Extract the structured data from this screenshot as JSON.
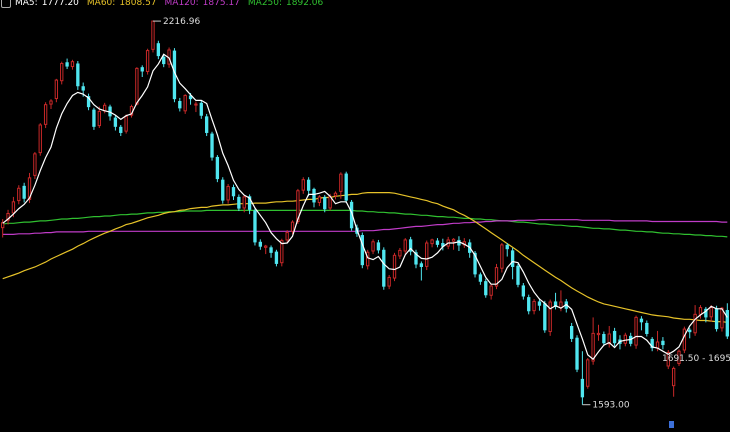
{
  "chart_data": {
    "type": "candlestick",
    "ylim": [
      1560,
      2235
    ],
    "up_color": "#c82828",
    "down_color": "#50e6f0",
    "legend": {
      "ma5": {
        "label": "MA5:",
        "value": "1777.20",
        "color": "#ffffff"
      },
      "ma60": {
        "label": "MA60:",
        "value": "1808.57",
        "color": "#e6c229"
      },
      "ma120": {
        "label": "MA120:",
        "value": "1875.17",
        "color": "#c03cc8"
      },
      "ma250": {
        "label": "MA250:",
        "value": "1892.06",
        "color": "#30c030"
      }
    },
    "annotations": {
      "high": {
        "text": "2216.96",
        "value": 2216.96
      },
      "low": {
        "text": "1593.00",
        "value": 1593.0
      },
      "range_text": "1691.50 - 1695"
    },
    "candles": [
      [
        1881,
        1889,
        1865,
        1895
      ],
      [
        1893,
        1904,
        1886,
        1910
      ],
      [
        1905,
        1923,
        1898,
        1931
      ],
      [
        1925,
        1945,
        1919,
        1950
      ],
      [
        1949,
        1928,
        1922,
        1954
      ],
      [
        1927,
        1962,
        1921,
        1970
      ],
      [
        1966,
        2001,
        1960,
        2004
      ],
      [
        2003,
        2048,
        1998,
        2051
      ],
      [
        2049,
        2081,
        2043,
        2085
      ],
      [
        2082,
        2087,
        2074,
        2090
      ],
      [
        2091,
        2121,
        2085,
        2123
      ],
      [
        2120,
        2148,
        2114,
        2151
      ],
      [
        2150,
        2143,
        2139,
        2156
      ],
      [
        2143,
        2151,
        2138,
        2154
      ],
      [
        2148,
        2111,
        2105,
        2152
      ],
      [
        2111,
        2104,
        2094,
        2117
      ],
      [
        2095,
        2077,
        2072,
        2099
      ],
      [
        2073,
        2045,
        2040,
        2076
      ],
      [
        2047,
        2070,
        2043,
        2078
      ],
      [
        2071,
        2080,
        2067,
        2084
      ],
      [
        2078,
        2062,
        2055,
        2081
      ],
      [
        2060,
        2045,
        2039,
        2064
      ],
      [
        2045,
        2035,
        2030,
        2048
      ],
      [
        2038,
        2062,
        2034,
        2065
      ],
      [
        2064,
        2078,
        2060,
        2081
      ],
      [
        2082,
        2140,
        2080,
        2142
      ],
      [
        2142,
        2135,
        2126,
        2145
      ],
      [
        2135,
        2169,
        2130,
        2172
      ],
      [
        2171,
        2217,
        2166,
        2217
      ],
      [
        2181,
        2160,
        2155,
        2185
      ],
      [
        2159,
        2147,
        2142,
        2162
      ],
      [
        2147,
        2170,
        2141,
        2174
      ],
      [
        2169,
        2090,
        2085,
        2173
      ],
      [
        2087,
        2075,
        2070,
        2092
      ],
      [
        2071,
        2096,
        2066,
        2098
      ],
      [
        2096,
        2090,
        2081,
        2100
      ],
      [
        2082,
        2082,
        2069,
        2086
      ],
      [
        2084,
        2063,
        2058,
        2088
      ],
      [
        2062,
        2035,
        2030,
        2066
      ],
      [
        2034,
        1995,
        1990,
        2037
      ],
      [
        1996,
        1960,
        1955,
        1999
      ],
      [
        1959,
        1925,
        1920,
        1963
      ],
      [
        1926,
        1948,
        1920,
        1952
      ],
      [
        1947,
        1932,
        1926,
        1951
      ],
      [
        1931,
        1912,
        1908,
        1935
      ],
      [
        1913,
        1931,
        1906,
        1934
      ],
      [
        1932,
        1910,
        1903,
        1935
      ],
      [
        1909,
        1857,
        1852,
        1912
      ],
      [
        1858,
        1850,
        1845,
        1862
      ],
      [
        1849,
        1851,
        1838,
        1853
      ],
      [
        1849,
        1840,
        1832,
        1852
      ],
      [
        1842,
        1822,
        1818,
        1845
      ],
      [
        1824,
        1860,
        1818,
        1863
      ],
      [
        1861,
        1873,
        1856,
        1877
      ],
      [
        1875,
        1890,
        1870,
        1893
      ],
      [
        1891,
        1941,
        1887,
        1944
      ],
      [
        1942,
        1959,
        1936,
        1963
      ],
      [
        1959,
        1941,
        1932,
        1963
      ],
      [
        1944,
        1922,
        1914,
        1946
      ],
      [
        1922,
        1931,
        1916,
        1934
      ],
      [
        1931,
        1911,
        1906,
        1934
      ],
      [
        1913,
        1932,
        1909,
        1936
      ],
      [
        1933,
        1937,
        1927,
        1940
      ],
      [
        1940,
        1968,
        1928,
        1971
      ],
      [
        1969,
        1925,
        1921,
        1972
      ],
      [
        1923,
        1880,
        1876,
        1926
      ],
      [
        1881,
        1871,
        1866,
        1886
      ],
      [
        1869,
        1820,
        1815,
        1873
      ],
      [
        1819,
        1841,
        1813,
        1845
      ],
      [
        1843,
        1858,
        1838,
        1862
      ],
      [
        1857,
        1844,
        1839,
        1861
      ],
      [
        1845,
        1785,
        1780,
        1849
      ],
      [
        1786,
        1800,
        1781,
        1804
      ],
      [
        1799,
        1836,
        1794,
        1840
      ],
      [
        1835,
        1844,
        1830,
        1848
      ],
      [
        1843,
        1861,
        1838,
        1864
      ],
      [
        1862,
        1842,
        1836,
        1866
      ],
      [
        1841,
        1821,
        1815,
        1845
      ],
      [
        1823,
        1817,
        1795,
        1826
      ],
      [
        1818,
        1856,
        1812,
        1860
      ],
      [
        1855,
        1861,
        1849,
        1863
      ],
      [
        1860,
        1853,
        1849,
        1864
      ],
      [
        1856,
        1850,
        1844,
        1863
      ],
      [
        1851,
        1861,
        1846,
        1866
      ],
      [
        1859,
        1862,
        1845,
        1864
      ],
      [
        1861,
        1852,
        1843,
        1867
      ],
      [
        1853,
        1858,
        1848,
        1864
      ],
      [
        1857,
        1840,
        1832,
        1862
      ],
      [
        1840,
        1805,
        1800,
        1843
      ],
      [
        1805,
        1793,
        1788,
        1808
      ],
      [
        1794,
        1771,
        1767,
        1798
      ],
      [
        1771,
        1786,
        1764,
        1790
      ],
      [
        1786,
        1816,
        1781,
        1822
      ],
      [
        1815,
        1853,
        1808,
        1856
      ],
      [
        1853,
        1846,
        1834,
        1856
      ],
      [
        1844,
        1817,
        1797,
        1848
      ],
      [
        1819,
        1788,
        1784,
        1822
      ],
      [
        1787,
        1769,
        1764,
        1791
      ],
      [
        1768,
        1745,
        1740,
        1772
      ],
      [
        1746,
        1761,
        1740,
        1765
      ],
      [
        1761,
        1754,
        1746,
        1766
      ],
      [
        1758,
        1714,
        1710,
        1762
      ],
      [
        1712,
        1760,
        1705,
        1764
      ],
      [
        1761,
        1752,
        1748,
        1775
      ],
      [
        1751,
        1760,
        1745,
        1779
      ],
      [
        1761,
        1749,
        1743,
        1765
      ],
      [
        1721,
        1700,
        1695,
        1726
      ],
      [
        1702,
        1650,
        1646,
        1706
      ],
      [
        1635,
        1605,
        1593,
        1680
      ],
      [
        1623,
        1666,
        1619,
        1669
      ],
      [
        1664,
        1709,
        1658,
        1735
      ],
      [
        1707,
        1709,
        1697,
        1723
      ],
      [
        1708,
        1693,
        1689,
        1712
      ],
      [
        1692,
        1708,
        1686,
        1721
      ],
      [
        1713,
        1693,
        1688,
        1718
      ],
      [
        1699,
        1692,
        1683,
        1706
      ],
      [
        1693,
        1706,
        1688,
        1710
      ],
      [
        1705,
        1692,
        1688,
        1710
      ],
      [
        1690,
        1735,
        1684,
        1738
      ],
      [
        1733,
        1727,
        1714,
        1737
      ],
      [
        1726,
        1708,
        1704,
        1730
      ],
      [
        1700,
        1685,
        1680,
        1703
      ],
      [
        1685,
        1695,
        1680,
        1713
      ],
      [
        1697,
        1690,
        1683,
        1703
      ],
      [
        1656,
        1678,
        1651,
        1682
      ],
      [
        1624,
        1652,
        1606,
        1655
      ],
      [
        1660,
        1680,
        1656,
        1683
      ],
      [
        1682,
        1716,
        1677,
        1720
      ],
      [
        1715,
        1711,
        1701,
        1718
      ],
      [
        1710,
        1740,
        1705,
        1755
      ],
      [
        1740,
        1751,
        1733,
        1755
      ],
      [
        1749,
        1735,
        1727,
        1752
      ],
      [
        1736,
        1751,
        1728,
        1755
      ],
      [
        1750,
        1716,
        1712,
        1754
      ],
      [
        1718,
        1750,
        1712,
        1752
      ],
      [
        1747,
        1704,
        1700,
        1758
      ]
    ],
    "ma5": [
      1888,
      1895,
      1903,
      1912,
      1919,
      1929,
      1950,
      1974,
      1995,
      2012,
      2043,
      2066,
      2083,
      2096,
      2101,
      2098,
      2092,
      2081,
      2074,
      2071,
      2069,
      2064,
      2057,
      2063,
      2066,
      2084,
      2096,
      2110,
      2136,
      2147,
      2163,
      2157,
      2134,
      2116,
      2107,
      2097,
      2088,
      2088,
      2083,
      2057,
      2032,
      2002,
      1982,
      1958,
      1943,
      1934,
      1929,
      1913,
      1901,
      1889,
      1873,
      1863,
      1855,
      1856,
      1867,
      1895,
      1917,
      1935,
      1935,
      1937,
      1940,
      1932,
      1920,
      1923,
      1923,
      1906,
      1878,
      1854,
      1832,
      1829,
      1834,
      1822,
      1814,
      1813,
      1817,
      1837,
      1847,
      1838,
      1831,
      1830,
      1833,
      1840,
      1850,
      1856,
      1856,
      1858,
      1854,
      1849,
      1836,
      1818,
      1800,
      1789,
      1789,
      1797,
      1816,
      1826,
      1824,
      1809,
      1791,
      1776,
      1765,
      1758,
      1749,
      1754,
      1750,
      1756,
      1748,
      1724,
      1700,
      1674,
      1667,
      1679,
      1690,
      1694,
      1686,
      1696,
      1698,
      1699,
      1704,
      1704,
      1698,
      1687,
      1685,
      1680,
      1675,
      1680,
      1687,
      1705,
      1721,
      1732,
      1739,
      1745,
      1753,
      1749,
      1749,
      1735
    ],
    "ma60": [
      1798,
      1801,
      1804,
      1807,
      1811,
      1814,
      1817,
      1821,
      1825,
      1830,
      1834,
      1838,
      1842,
      1846,
      1851,
      1855,
      1860,
      1864,
      1868,
      1872,
      1875,
      1879,
      1882,
      1886,
      1888,
      1891,
      1894,
      1897,
      1899,
      1901,
      1904,
      1906,
      1907,
      1909,
      1910,
      1912,
      1913,
      1914,
      1914,
      1916,
      1917,
      1918,
      1918,
      1919,
      1920,
      1920,
      1920,
      1921,
      1921,
      1921,
      1922,
      1923,
      1923,
      1924,
      1924,
      1925,
      1926,
      1927,
      1927,
      1929,
      1930,
      1930,
      1932,
      1933,
      1934,
      1935,
      1935,
      1937,
      1938,
      1938,
      1938,
      1938,
      1938,
      1937,
      1935,
      1933,
      1931,
      1929,
      1927,
      1925,
      1922,
      1920,
      1916,
      1913,
      1910,
      1905,
      1901,
      1896,
      1891,
      1885,
      1879,
      1873,
      1867,
      1861,
      1855,
      1849,
      1843,
      1836,
      1830,
      1824,
      1818,
      1812,
      1806,
      1800,
      1795,
      1789,
      1783,
      1778,
      1773,
      1768,
      1764,
      1760,
      1757,
      1755,
      1753,
      1751,
      1749,
      1747,
      1745,
      1743,
      1741,
      1739,
      1738,
      1737,
      1736,
      1734,
      1733,
      1732,
      1732,
      1731,
      1730,
      1730,
      1729,
      1728,
      1728,
      1727
    ],
    "ma120": [
      1870,
      1870,
      1870,
      1871,
      1871,
      1871,
      1872,
      1872,
      1873,
      1873,
      1874,
      1874,
      1874,
      1874,
      1874,
      1874,
      1875,
      1875,
      1875,
      1875,
      1875,
      1875,
      1875,
      1875,
      1875,
      1875,
      1875,
      1875,
      1875,
      1875,
      1875,
      1875,
      1875,
      1875,
      1875,
      1875,
      1875,
      1875,
      1875,
      1875,
      1875,
      1875,
      1875,
      1875,
      1875,
      1875,
      1875,
      1875,
      1875,
      1875,
      1875,
      1875,
      1875,
      1875,
      1875,
      1875,
      1875,
      1875,
      1875,
      1875,
      1875,
      1875,
      1875,
      1875,
      1875,
      1875,
      1875,
      1876,
      1876,
      1876,
      1877,
      1878,
      1878,
      1879,
      1880,
      1881,
      1882,
      1883,
      1883,
      1884,
      1885,
      1886,
      1886,
      1887,
      1888,
      1888,
      1889,
      1889,
      1890,
      1890,
      1891,
      1891,
      1892,
      1892,
      1892,
      1892,
      1893,
      1893,
      1893,
      1893,
      1894,
      1894,
      1894,
      1894,
      1894,
      1894,
      1894,
      1894,
      1893,
      1893,
      1893,
      1893,
      1893,
      1893,
      1892,
      1892,
      1892,
      1892,
      1892,
      1892,
      1892,
      1891,
      1891,
      1891,
      1891,
      1891,
      1891,
      1891,
      1891,
      1891,
      1891,
      1891,
      1891,
      1891,
      1890,
      1890
    ],
    "ma250": [
      1887,
      1888,
      1888,
      1889,
      1890,
      1890,
      1891,
      1892,
      1892,
      1893,
      1894,
      1895,
      1895,
      1896,
      1896,
      1897,
      1898,
      1899,
      1899,
      1900,
      1900,
      1901,
      1902,
      1902,
      1903,
      1903,
      1904,
      1905,
      1905,
      1906,
      1906,
      1907,
      1907,
      1907,
      1908,
      1908,
      1908,
      1908,
      1909,
      1909,
      1909,
      1909,
      1909,
      1909,
      1909,
      1909,
      1909,
      1909,
      1909,
      1909,
      1909,
      1909,
      1909,
      1909,
      1909,
      1909,
      1909,
      1909,
      1909,
      1909,
      1909,
      1909,
      1909,
      1909,
      1909,
      1909,
      1908,
      1908,
      1907,
      1907,
      1906,
      1906,
      1905,
      1905,
      1904,
      1903,
      1903,
      1902,
      1901,
      1901,
      1900,
      1899,
      1899,
      1898,
      1898,
      1897,
      1896,
      1896,
      1895,
      1895,
      1894,
      1894,
      1893,
      1892,
      1892,
      1891,
      1890,
      1890,
      1889,
      1888,
      1887,
      1887,
      1886,
      1885,
      1885,
      1884,
      1883,
      1883,
      1882,
      1881,
      1880,
      1880,
      1879,
      1879,
      1878,
      1877,
      1877,
      1876,
      1875,
      1875,
      1874,
      1874,
      1873,
      1872,
      1872,
      1871,
      1871,
      1870,
      1870,
      1869,
      1869,
      1868,
      1868,
      1867,
      1867,
      1866
    ]
  }
}
